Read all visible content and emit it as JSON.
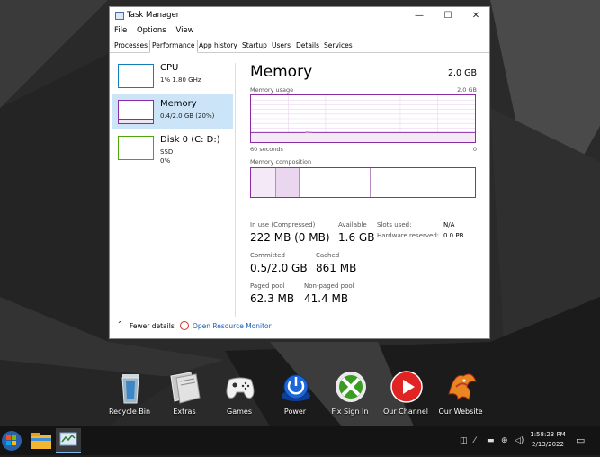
{
  "window": {
    "title": "Task Manager",
    "minimize": "—",
    "maximize": "☐",
    "close": "✕",
    "menu": [
      "File",
      "Options",
      "View"
    ],
    "tabs": [
      "Processes",
      "Performance",
      "App history",
      "Startup",
      "Users",
      "Details",
      "Services"
    ]
  },
  "resources": [
    {
      "name": "CPU",
      "sub1": "1% 1.80 GHz",
      "sub2": ""
    },
    {
      "name": "Memory",
      "sub1": "0.4/2.0 GB (20%)",
      "sub2": ""
    },
    {
      "name": "Disk 0 (C: D:)",
      "sub1": "SSD",
      "sub2": "0%"
    }
  ],
  "main": {
    "title": "Memory",
    "total": "2.0 GB",
    "usage_label": "Memory usage",
    "usage_max": "2.0 GB",
    "axis_left": "60 seconds",
    "axis_right": "0",
    "composition_label": "Memory composition",
    "stats": {
      "in_use_label": "In use (Compressed)",
      "in_use": "222 MB (0 MB)",
      "available_label": "Available",
      "available": "1.6 GB",
      "slots_label": "Slots used:",
      "slots": "N/A",
      "hw_reserved_label": "Hardware reserved:",
      "hw_reserved": "0.0 PB",
      "committed_label": "Committed",
      "committed": "0.5/2.0 GB",
      "cached_label": "Cached",
      "cached": "861 MB",
      "paged_label": "Paged pool",
      "paged": "62.3 MB",
      "nonpaged_label": "Non-paged pool",
      "nonpaged": "41.4 MB"
    }
  },
  "footer": {
    "fewer_details": "Fewer details",
    "open_monitor": "Open Resource Monitor"
  },
  "desktop_icons": [
    {
      "label": "Recycle Bin",
      "icon": "recycle-bin-icon"
    },
    {
      "label": "Extras",
      "icon": "folder-icon"
    },
    {
      "label": "Games",
      "icon": "gamepad-icon"
    },
    {
      "label": "Power",
      "icon": "power-icon"
    },
    {
      "label": "Fix Sign In",
      "icon": "xbox-icon"
    },
    {
      "label": "Our Channel",
      "icon": "youtube-icon"
    },
    {
      "label": "Our Website",
      "icon": "phoenix-icon"
    }
  ],
  "taskbar": {
    "time": "1:58:23 PM",
    "date": "2/13/2022"
  },
  "colors": {
    "memory_accent": "#8b2ca4",
    "cpu_accent": "#117dbb",
    "disk_accent": "#4da60c",
    "selection": "#cce4f7"
  }
}
